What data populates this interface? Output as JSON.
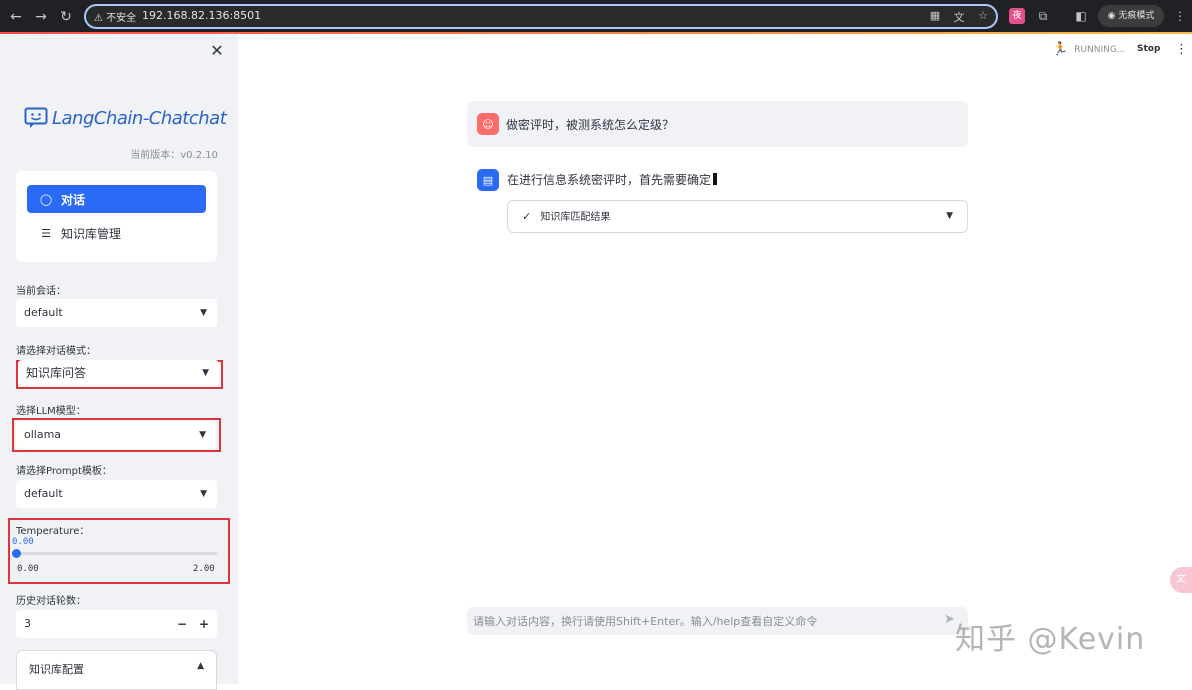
{
  "browser": {
    "security_label": "不安全",
    "url": "192.168.82.136:8501",
    "incognito_label": "无痕模式"
  },
  "sidebar": {
    "app_name": "LangChain-Chatchat",
    "version": "当前版本：v0.2.10",
    "menu": [
      {
        "label": "对话",
        "icon": "chat-bubble-icon",
        "active": true
      },
      {
        "label": "知识库管理",
        "icon": "database-icon",
        "active": false
      }
    ],
    "conversation": {
      "label": "当前会话：",
      "value": "default"
    },
    "dialog_mode": {
      "label": "请选择对话模式：",
      "value": "知识库问答"
    },
    "llm_model": {
      "label": "选择LLM模型：",
      "value": "ollama"
    },
    "prompt_template": {
      "label": "请选择Prompt模板：",
      "value": "default"
    },
    "temperature": {
      "label": "Temperature：",
      "value": "0.00",
      "min": "0.00",
      "max": "2.00",
      "fraction": 0
    },
    "history_turns": {
      "label": "历史对话轮数：",
      "value": "3",
      "minus": "−",
      "plus": "+"
    },
    "kb_config": {
      "label": "知识库配置"
    }
  },
  "status": {
    "running": "RUNNING...",
    "stop": "Stop"
  },
  "chat": {
    "user_message": "做密评时，被测系统怎么定级？",
    "bot_message": "在进行信息系统密评时，首先需要确定",
    "kb_result_label": "知识库匹配结果",
    "input_placeholder": "请输入对话内容，换行请使用Shift+Enter。输入/help查看自定义命令"
  },
  "watermark": "知乎 @Kevin",
  "colors": {
    "accent": "#2a6af5",
    "highlight_border": "#d9363e",
    "user_avatar": "#ff6b6b",
    "sidebar_bg": "#f0f2f6"
  }
}
